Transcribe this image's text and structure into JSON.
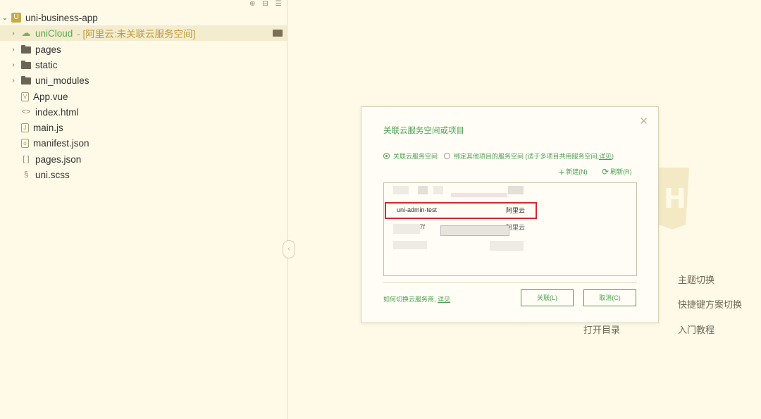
{
  "sidebar": {
    "toolbar_icons": [
      "locate-icon",
      "collapse-all-icon",
      "menu-icon"
    ],
    "project": {
      "name": "uni-business-app",
      "arrow": "⌄",
      "icon": "project-icon"
    },
    "items": [
      {
        "label": "uniCloud",
        "hint": "- [阿里云:未关联云服务空间]",
        "arrow": "›",
        "icon": "cloud-folder-icon"
      },
      {
        "label": "pages",
        "arrow": "›",
        "icon": "folder-icon"
      },
      {
        "label": "static",
        "arrow": "›",
        "icon": "folder-icon"
      },
      {
        "label": "uni_modules",
        "arrow": "›",
        "icon": "folder-icon"
      },
      {
        "label": "App.vue",
        "icon": "vue-file-icon"
      },
      {
        "label": "index.html",
        "icon": "code-file-icon"
      },
      {
        "label": "main.js",
        "icon": "js-file-icon"
      },
      {
        "label": "manifest.json",
        "icon": "manifest-file-icon"
      },
      {
        "label": "pages.json",
        "icon": "json-file-icon"
      },
      {
        "label": "uni.scss",
        "icon": "scss-file-icon"
      }
    ]
  },
  "background_hints": {
    "theme_switch": "主题切换",
    "shortcut_switch": "快捷键方案切换",
    "open_directory": "打开目录",
    "getting_started": "入门教程"
  },
  "dialog": {
    "title": "关联云服务空间或项目",
    "radio_options": [
      {
        "label": "关联云服务空间",
        "checked": true
      },
      {
        "label": "绑定其他项目的服务空间 (适于多项目共用服务空间,",
        "link": "详见",
        "suffix": ")",
        "checked": false
      }
    ],
    "new_label": "新建(N)",
    "refresh_label": "刷新(R)",
    "spaces": [
      {
        "name": "uni-admin-test",
        "provider": "阿里云"
      },
      {
        "name": "u i 2 - 3 7f",
        "provider": "阿里云"
      }
    ],
    "how_switch_text": "如何切换云服务商,",
    "how_switch_link": "详见",
    "associate_button": "关联(L)",
    "cancel_button": "取消(C)"
  },
  "colors": {
    "accent_green": "#4aa152",
    "highlight_red": "#d9262f",
    "background": "#fffae8"
  }
}
